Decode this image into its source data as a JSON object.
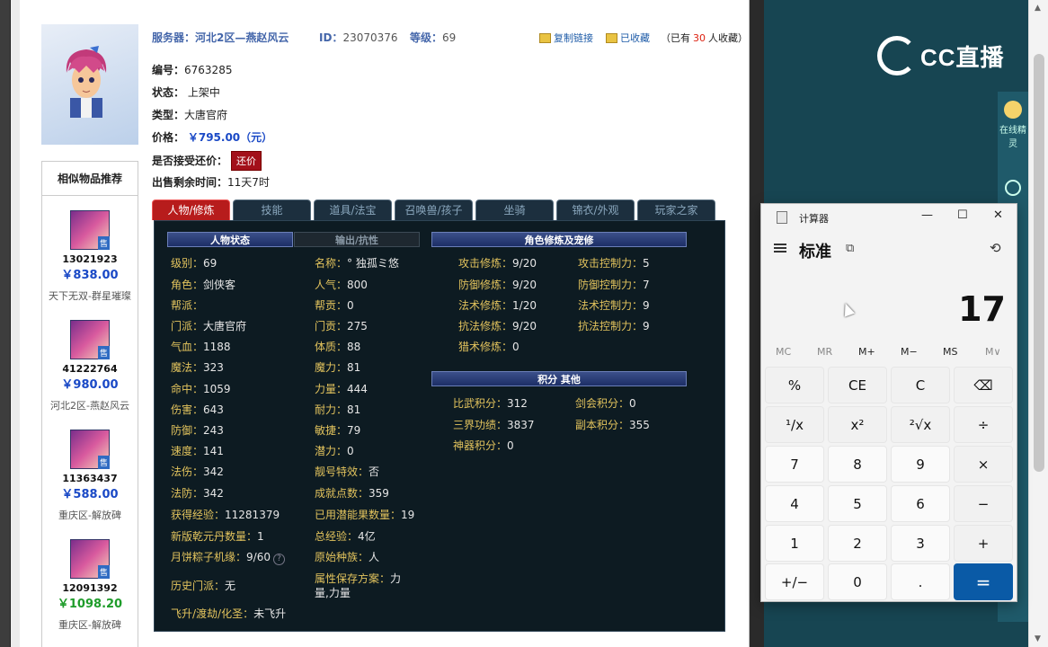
{
  "listing": {
    "server": "服务器：河北2区—燕赵风云",
    "id_label": "ID：",
    "id_value": "23070376",
    "level_label": "等级：",
    "level_value": "69",
    "copy_link": "复制链接",
    "favorited": "已收藏",
    "fav_prefix": "（已有",
    "fav_count": "30",
    "fav_suffix": "人收藏）",
    "serial_label": "编号：",
    "serial_value": "6763285",
    "status_label": "状态：",
    "status_value": "上架中",
    "type_label": "类型：",
    "type_value": "大唐官府",
    "price_label": "价格：",
    "price_value": "￥795.00（元）",
    "haggle_label": "是否接受还价：",
    "haggle_button": "还价",
    "remain_label": "出售剩余时间：",
    "remain_value": "11天7时"
  },
  "similar": {
    "title": "相似物品推荐",
    "sell_badge": "售",
    "items": [
      {
        "id": "13021923",
        "price": "￥838.00",
        "server": "天下无双-群星璀璨"
      },
      {
        "id": "41222764",
        "price": "￥980.00",
        "server": "河北2区-燕赵风云"
      },
      {
        "id": "11363437",
        "price": "￥588.00",
        "server": "重庆区-解放碑"
      },
      {
        "id": "12091392",
        "price": "￥1098.20",
        "server": "重庆区-解放碑"
      }
    ]
  },
  "tabs": [
    "人物/修炼",
    "技能",
    "道具/法宝",
    "召唤兽/孩子",
    "坐骑",
    "锦衣/外观",
    "玩家之家"
  ],
  "panel": {
    "sec_status": "人物状态",
    "sec_resist": "输出/抗性",
    "sec_cultivate": "角色修炼及宠修",
    "sec_points": "积分 其他",
    "col1": [
      {
        "k": "级别：",
        "v": "69"
      },
      {
        "k": "角色：",
        "v": "剑侠客"
      },
      {
        "k": "帮派：",
        "v": ""
      },
      {
        "k": "门派：",
        "v": "大唐官府"
      },
      {
        "k": "气血：",
        "v": "1188"
      },
      {
        "k": "魔法：",
        "v": "323"
      },
      {
        "k": "命中：",
        "v": "1059"
      },
      {
        "k": "伤害：",
        "v": "643"
      },
      {
        "k": "防御：",
        "v": "243"
      },
      {
        "k": "速度：",
        "v": "141"
      },
      {
        "k": "法伤：",
        "v": "342"
      },
      {
        "k": "法防：",
        "v": "342"
      },
      {
        "k": "获得经验：",
        "v": "11281379"
      },
      {
        "k": "新版乾元丹数量：",
        "v": "1"
      },
      {
        "k": "月饼粽子机缘：",
        "v": "9/60"
      },
      {
        "k": "历史门派：",
        "v": "无"
      },
      {
        "k": "飞升/渡劫/化圣：",
        "v": "未飞升"
      }
    ],
    "col2": [
      {
        "k": "名称：",
        "v": "° 独孤ミ悠"
      },
      {
        "k": "人气：",
        "v": "800"
      },
      {
        "k": "帮贡：",
        "v": "0"
      },
      {
        "k": "门贡：",
        "v": "275"
      },
      {
        "k": "体质：",
        "v": "88"
      },
      {
        "k": "魔力：",
        "v": "81"
      },
      {
        "k": "力量：",
        "v": "444"
      },
      {
        "k": "耐力：",
        "v": "81"
      },
      {
        "k": "敏捷：",
        "v": "79"
      },
      {
        "k": "潜力：",
        "v": "0"
      },
      {
        "k": "靓号特效：",
        "v": "否"
      },
      {
        "k": "成就点数：",
        "v": "359"
      },
      {
        "k": "已用潜能果数量：",
        "v": "19"
      },
      {
        "k": "总经验：",
        "v": "4亿"
      },
      {
        "k": "原始种族：",
        "v": "人"
      },
      {
        "k": "属性保存方案：",
        "v": "力"
      },
      {
        "k": "",
        "v": "量,力量"
      }
    ],
    "cult_left": [
      {
        "k": "攻击修炼：",
        "v": "9/20"
      },
      {
        "k": "防御修炼：",
        "v": "9/20"
      },
      {
        "k": "法术修炼：",
        "v": "1/20"
      },
      {
        "k": "抗法修炼：",
        "v": "9/20"
      },
      {
        "k": "猎术修炼：",
        "v": "0"
      }
    ],
    "cult_right": [
      {
        "k": "攻击控制力：",
        "v": "5"
      },
      {
        "k": "防御控制力：",
        "v": "7"
      },
      {
        "k": "法术控制力：",
        "v": "9"
      },
      {
        "k": "抗法控制力：",
        "v": "9"
      }
    ],
    "pts_left": [
      {
        "k": "比武积分：",
        "v": "312"
      },
      {
        "k": "三界功绩：",
        "v": "3837"
      },
      {
        "k": "神器积分：",
        "v": "0"
      }
    ],
    "pts_right": [
      {
        "k": "剑会积分：",
        "v": "0"
      },
      {
        "k": "副本积分：",
        "v": "355"
      }
    ]
  },
  "cc": {
    "logo": "CC直播",
    "side_label": "在线精灵"
  },
  "calculator": {
    "title": "计算器",
    "mode": "标准",
    "display": "17",
    "memory": [
      "MC",
      "MR",
      "M+",
      "M−",
      "MS",
      "M∨"
    ],
    "keys": [
      [
        "%",
        "CE",
        "C",
        "⌫"
      ],
      [
        "¹/x",
        "x²",
        "²√x",
        "÷"
      ],
      [
        "7",
        "8",
        "9",
        "×"
      ],
      [
        "4",
        "5",
        "6",
        "−"
      ],
      [
        "1",
        "2",
        "3",
        "+"
      ],
      [
        "+/−",
        "0",
        ".",
        "="
      ]
    ]
  },
  "colors": {
    "accent_blue": "#0a5aa6",
    "cc_bg": "#174552",
    "price_blue": "#1a49c6",
    "tab_active": "#b71c1c"
  }
}
